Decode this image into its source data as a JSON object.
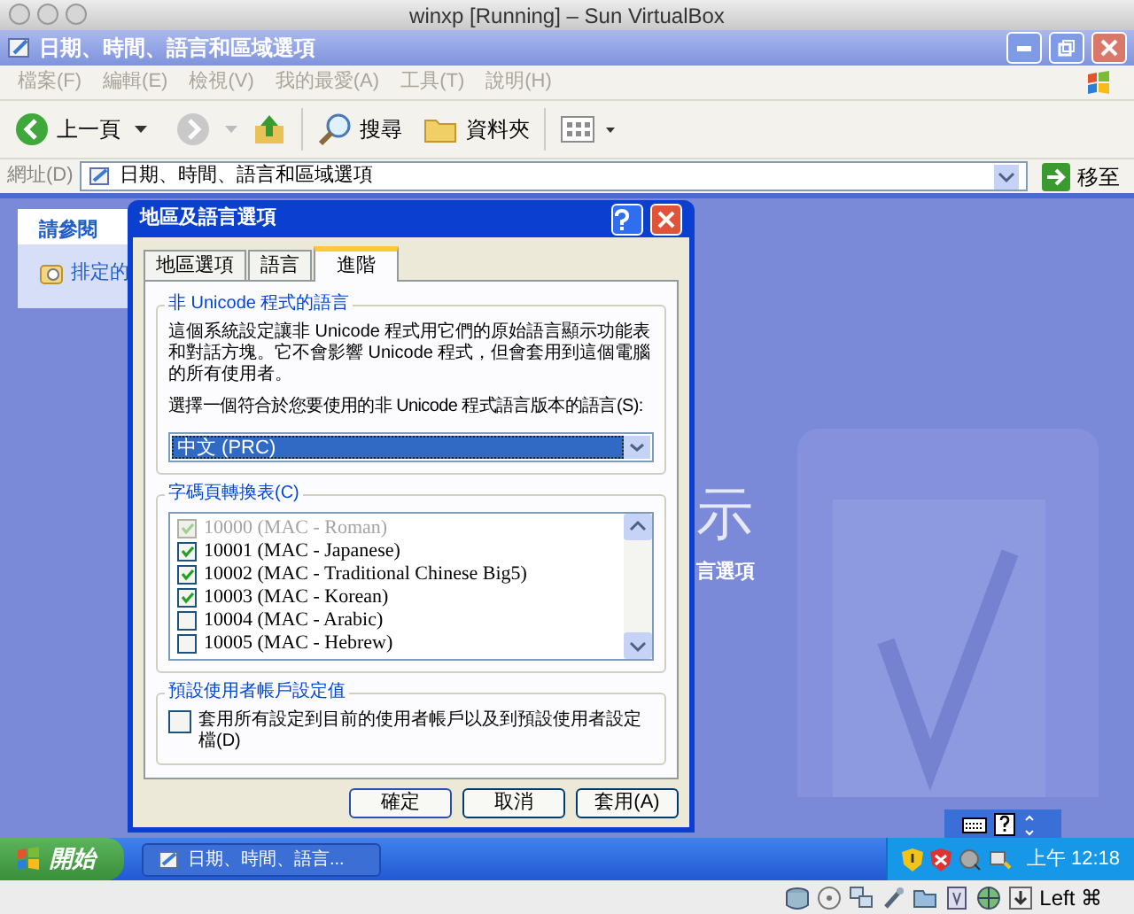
{
  "host_window": {
    "title": "winxp [Running] – Sun VirtualBox"
  },
  "window": {
    "title": "日期、時間、語言和區域選項"
  },
  "menu": [
    "檔案(F)",
    "編輯(E)",
    "檢視(V)",
    "我的最愛(A)",
    "工具(T)",
    "說明(H)"
  ],
  "toolbar": {
    "back": "上一頁",
    "search": "搜尋",
    "folders": "資料夾"
  },
  "address": {
    "label": "網址(D)",
    "value": "日期、時間、語言和區域選項",
    "go": "移至"
  },
  "see_also": {
    "title": "請參閱",
    "items": [
      "排定的"
    ]
  },
  "background": {
    "heading": "示",
    "subtitle": "言選項"
  },
  "dialog": {
    "title": "地區及語言選項",
    "tabs": [
      {
        "label": "地區選項",
        "selected": false
      },
      {
        "label": "語言",
        "selected": false
      },
      {
        "label": "進階",
        "selected": true
      }
    ],
    "non_unicode": {
      "title": "非 Unicode 程式的語言",
      "description": "這個系統設定讓非 Unicode 程式用它們的原始語言顯示功能表和對話方塊。它不會影響 Unicode 程式，但會套用到這個電腦的所有使用者。",
      "prompt": "選擇一個符合於您要使用的非 Unicode 程式語言版本的語言(S):",
      "value": "中文 (PRC)"
    },
    "code_pages": {
      "title": "字碼頁轉換表(C)",
      "items": [
        {
          "label": "10000 (MAC - Roman)",
          "checked": true,
          "disabled": true
        },
        {
          "label": "10001 (MAC - Japanese)",
          "checked": true,
          "disabled": false
        },
        {
          "label": "10002 (MAC - Traditional Chinese Big5)",
          "checked": true,
          "disabled": false
        },
        {
          "label": "10003 (MAC - Korean)",
          "checked": true,
          "disabled": false
        },
        {
          "label": "10004 (MAC - Arabic)",
          "checked": false,
          "disabled": false
        },
        {
          "label": "10005 (MAC - Hebrew)",
          "checked": false,
          "disabled": false
        }
      ]
    },
    "default_user": {
      "title": "預設使用者帳戶設定值",
      "label": "套用所有設定到目前的使用者帳戶以及到預設使用者設定檔(D)",
      "checked": false
    },
    "buttons": [
      "確定",
      "取消",
      "套用(A)"
    ]
  },
  "taskbar": {
    "start": "開始",
    "task": "日期、時間、語言...",
    "clock": "上午 12:18"
  },
  "status_bar": {
    "host_key": "Left ⌘"
  }
}
